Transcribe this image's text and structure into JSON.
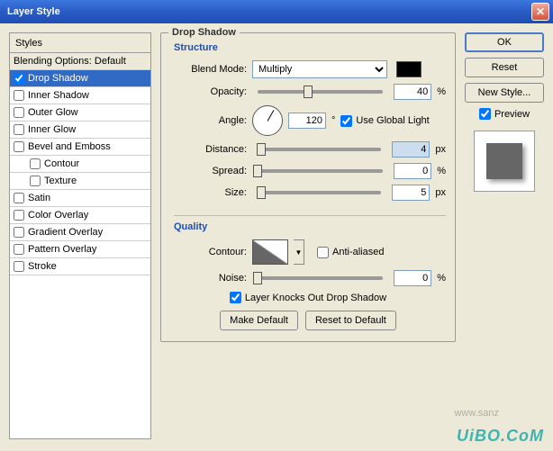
{
  "titlebar": {
    "title": "Layer Style"
  },
  "styles_header": "Styles",
  "styles": [
    {
      "label": "Blending Options: Default",
      "checked": null,
      "blend": true
    },
    {
      "label": "Drop Shadow",
      "checked": true,
      "selected": true
    },
    {
      "label": "Inner Shadow",
      "checked": false
    },
    {
      "label": "Outer Glow",
      "checked": false
    },
    {
      "label": "Inner Glow",
      "checked": false
    },
    {
      "label": "Bevel and Emboss",
      "checked": false
    },
    {
      "label": "Contour",
      "checked": false,
      "indent": true
    },
    {
      "label": "Texture",
      "checked": false,
      "indent": true
    },
    {
      "label": "Satin",
      "checked": false
    },
    {
      "label": "Color Overlay",
      "checked": false
    },
    {
      "label": "Gradient Overlay",
      "checked": false
    },
    {
      "label": "Pattern Overlay",
      "checked": false
    },
    {
      "label": "Stroke",
      "checked": false
    }
  ],
  "panel": {
    "title": "Drop Shadow",
    "structure_title": "Structure",
    "blend_mode_label": "Blend Mode:",
    "blend_mode_value": "Multiply",
    "color": "#000000",
    "opacity_label": "Opacity:",
    "opacity_value": "40",
    "opacity_unit": "%",
    "angle_label": "Angle:",
    "angle_value": "120",
    "angle_unit": "°",
    "global_light_label": "Use Global Light",
    "global_light_checked": true,
    "distance_label": "Distance:",
    "distance_value": "4",
    "distance_unit": "px",
    "spread_label": "Spread:",
    "spread_value": "0",
    "spread_unit": "%",
    "size_label": "Size:",
    "size_value": "5",
    "size_unit": "px",
    "quality_title": "Quality",
    "contour_label": "Contour:",
    "antialiased_label": "Anti-aliased",
    "antialiased_checked": false,
    "noise_label": "Noise:",
    "noise_value": "0",
    "noise_unit": "%",
    "knocks_out_label": "Layer Knocks Out Drop Shadow",
    "knocks_out_checked": true,
    "make_default": "Make Default",
    "reset_default": "Reset to Default"
  },
  "buttons": {
    "ok": "OK",
    "reset": "Reset",
    "new_style": "New Style...",
    "preview_label": "Preview",
    "preview_checked": true
  },
  "watermark": "UiBO.CoM",
  "watermark2": "www.sanz"
}
